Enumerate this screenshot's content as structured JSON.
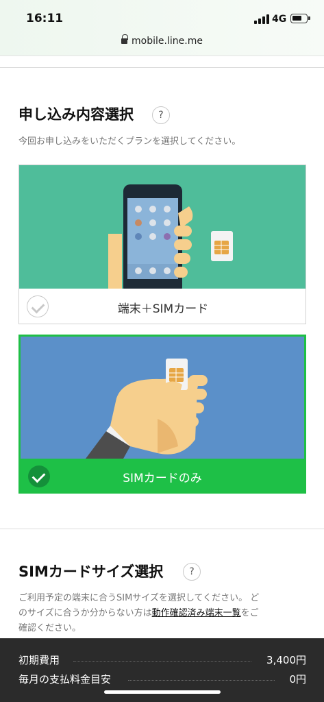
{
  "status_bar": {
    "time": "16:11",
    "network": "4G"
  },
  "browser": {
    "url": "mobile.line.me"
  },
  "plan_section": {
    "title": "申し込み内容選択",
    "help": "?",
    "description": "今回お申し込みをいただくプランを選択してください。",
    "options": [
      {
        "label": "端末＋SIMカード",
        "selected": false
      },
      {
        "label": "SIMカードのみ",
        "selected": true
      }
    ]
  },
  "sim_size_section": {
    "title": "SIMカードサイズ選択",
    "help": "?",
    "description_line1": "ご利用予定の端末に合うSIMサイズを選択してください。 ど",
    "description_line2_pre": "のサイズに合うか分からない方は",
    "description_link": "動作確認済み端末一覧",
    "description_line2_post": "をご",
    "description_line3": "確認ください。"
  },
  "fees": {
    "initial_label": "初期費用",
    "initial_value": "3,400円",
    "monthly_label": "毎月の支払料金目安",
    "monthly_value": "0円"
  },
  "colors": {
    "device_card_bg": "#4fbd9a",
    "sim_card_bg": "#5b90c9",
    "selected_green": "#1ec047",
    "footer_bg": "#2b2b2b"
  }
}
